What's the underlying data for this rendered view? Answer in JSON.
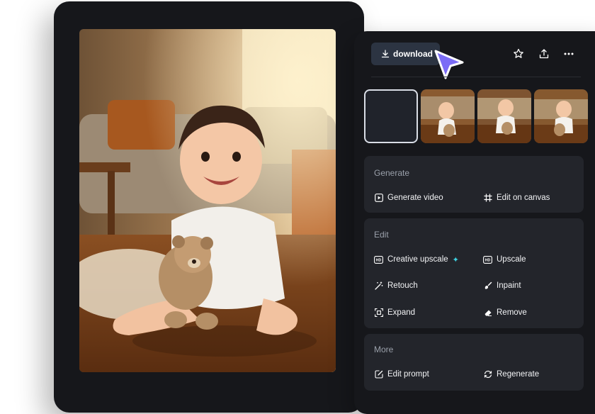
{
  "toolbar": {
    "download_label": "download",
    "favorite_icon": "star-icon",
    "share_icon": "share-icon",
    "more_icon": "more-icon"
  },
  "sections": {
    "generate": {
      "title": "Generate",
      "actions": [
        {
          "label": "Generate video",
          "icon": "play-video-icon"
        },
        {
          "label": "Edit on canvas",
          "icon": "canvas-icon"
        }
      ]
    },
    "edit": {
      "title": "Edit",
      "actions": [
        {
          "label": "Creative upscale",
          "icon": "hd-icon"
        },
        {
          "label": "Upscale",
          "icon": "hd-icon"
        },
        {
          "label": "Retouch",
          "icon": "magic-wand-icon"
        },
        {
          "label": "Inpaint",
          "icon": "paint-icon"
        },
        {
          "label": "Expand",
          "icon": "expand-icon"
        },
        {
          "label": "Remove",
          "icon": "eraser-icon"
        }
      ]
    },
    "more": {
      "title": "More",
      "actions": [
        {
          "label": "Edit prompt",
          "icon": "edit-prompt-icon"
        },
        {
          "label": "Regenerate",
          "icon": "regenerate-icon"
        }
      ]
    }
  },
  "colors": {
    "panel": "#16171b",
    "card": "#23252b",
    "button": "#2c3442",
    "cursor": "#7b6cf6",
    "sparkle": "#3ed1e0"
  }
}
